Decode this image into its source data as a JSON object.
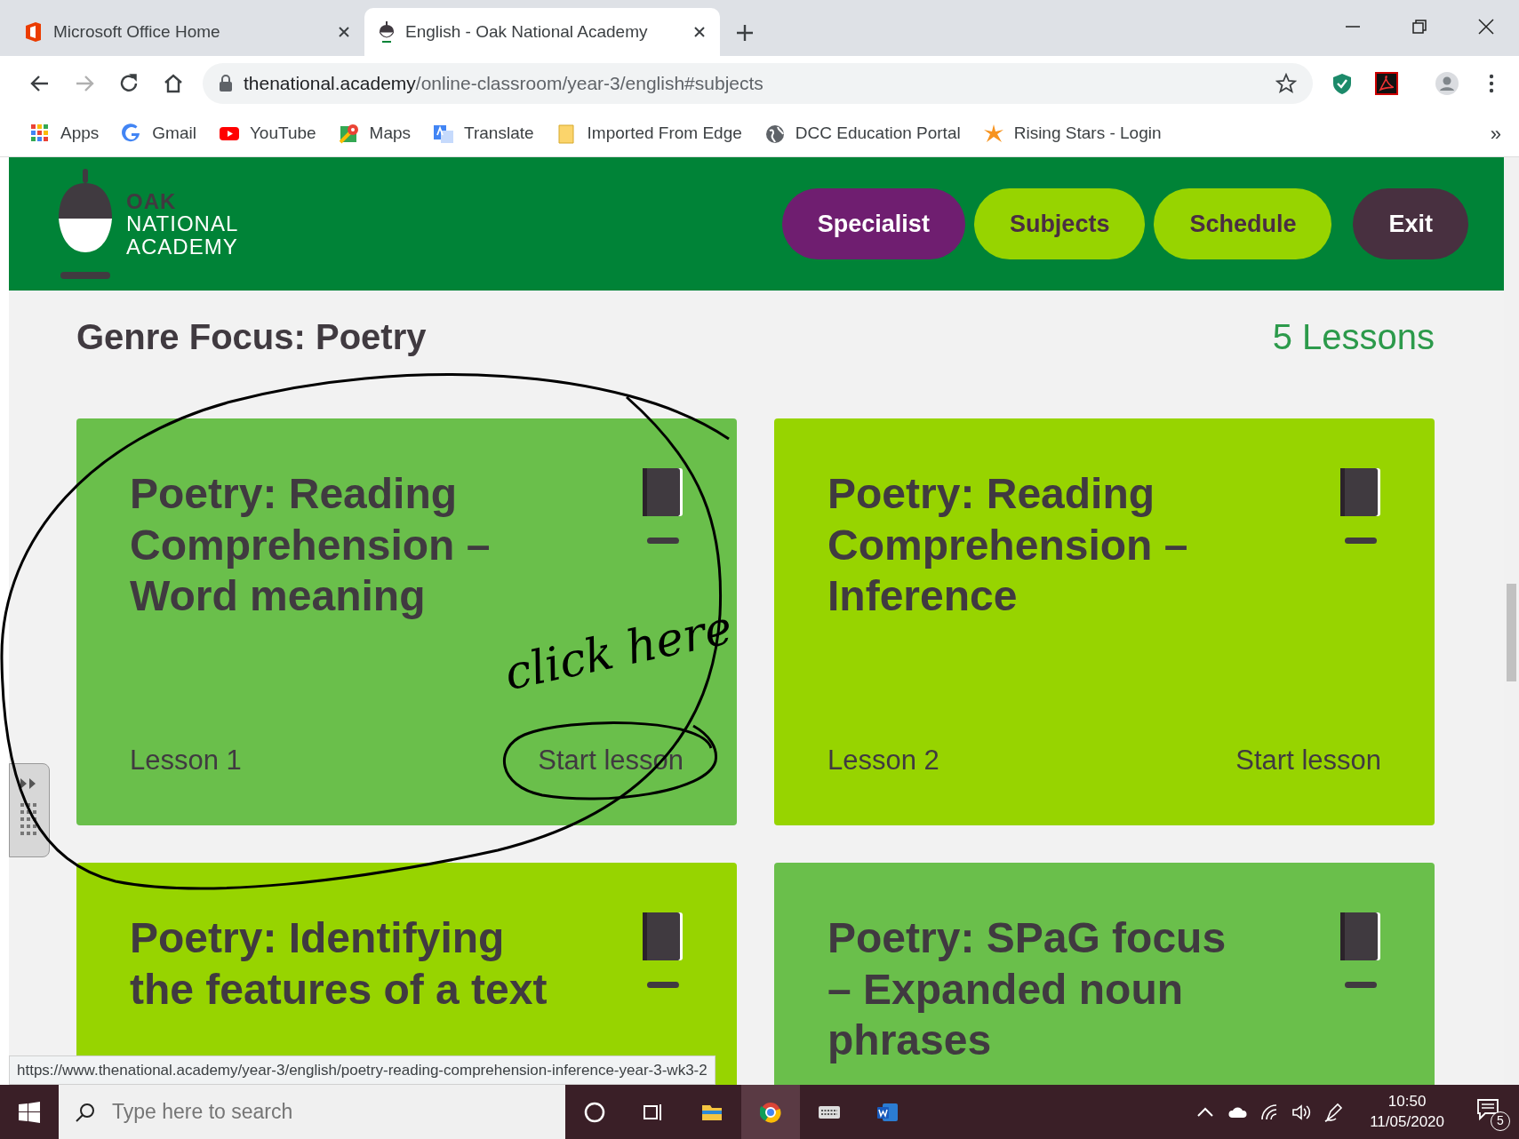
{
  "browser": {
    "tabs": [
      {
        "title": "Microsoft Office Home",
        "selected": false
      },
      {
        "title": "English - Oak National Academy",
        "selected": true
      }
    ],
    "address": {
      "domain": "thenational.academy",
      "path": "/online-classroom/year-3/english#subjects"
    },
    "bookmarks": [
      {
        "label": "Apps",
        "kind": "apps"
      },
      {
        "label": "Gmail",
        "kind": "google"
      },
      {
        "label": "YouTube",
        "kind": "youtube"
      },
      {
        "label": "Maps",
        "kind": "maps"
      },
      {
        "label": "Translate",
        "kind": "translate"
      },
      {
        "label": "Imported From Edge",
        "kind": "folder"
      },
      {
        "label": "DCC Education Portal",
        "kind": "globe"
      },
      {
        "label": "Rising Stars - Login",
        "kind": "star"
      }
    ],
    "bookmarks_overflow": "»"
  },
  "site": {
    "logo": [
      "OAK",
      "NATIONAL",
      "ACADEMY"
    ],
    "nav": [
      {
        "label": "Specialist",
        "kind": "specialist"
      },
      {
        "label": "Subjects",
        "kind": "plain"
      },
      {
        "label": "Schedule",
        "kind": "plain"
      },
      {
        "label": "Exit",
        "kind": "exit"
      }
    ],
    "section": {
      "title": "Genre Focus: Poetry",
      "count": "5 Lessons"
    },
    "lessons": [
      {
        "title": "Poetry: Reading Comprehension – Word meaning",
        "color": "#6abf4b",
        "lesson": "Lesson 1",
        "action": "Start lesson"
      },
      {
        "title": "Poetry: Reading Comprehension – Inference",
        "color": "#97d400",
        "lesson": "Lesson 2",
        "action": "Start lesson"
      },
      {
        "title": "Poetry: Identifying the features of a text",
        "color": "#97d400"
      },
      {
        "title": "Poetry: SPaG focus – Expanded noun phrases",
        "color": "#6abf4b"
      }
    ]
  },
  "annotation": {
    "text": "click here"
  },
  "status_url": "https://www.thenational.academy/year-3/english/poetry-reading-comprehension-inference-year-3-wk3-2",
  "taskbar": {
    "search_placeholder": "Type here to search",
    "time": "10:50",
    "date": "11/05/2020",
    "notifications": "5"
  }
}
